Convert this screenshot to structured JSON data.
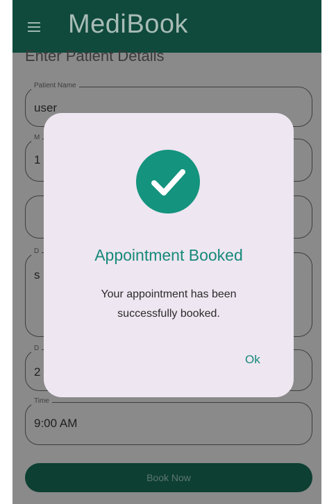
{
  "appbar": {
    "title": "MediBook",
    "menu_icon": "hamburger-menu-icon"
  },
  "form": {
    "section_title": "Enter Patient Details",
    "patient_name": {
      "label": "Patient Name",
      "value": "user"
    },
    "field2": {
      "label": "M",
      "value": "1"
    },
    "field4": {
      "label": "D",
      "value": "s"
    },
    "field5": {
      "label": "D",
      "value": "2"
    },
    "time": {
      "label": "Time",
      "value": "9:00 AM"
    },
    "book_button": "Book Now"
  },
  "dialog": {
    "icon": "check-circle-icon",
    "title": "Appointment Booked",
    "message": "Your appointment has been successfully booked.",
    "ok_label": "Ok"
  },
  "colors": {
    "appbar": "#0f4a3c",
    "accent": "#14937e",
    "dialog_bg": "#eee6f1",
    "button": "#0d3f33"
  }
}
